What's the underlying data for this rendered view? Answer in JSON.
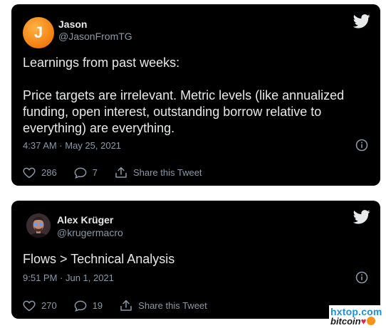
{
  "tweets": [
    {
      "avatar_letter": "J",
      "name": "Jason",
      "handle": "@JasonFromTG",
      "text_lines": [
        "Learnings from past weeks:",
        "",
        "Price targets are irrelevant.  Metric levels (like annualized",
        "funding, open interest, outstanding borrow relative to",
        "everything) are everything."
      ],
      "timestamp": "4:37 AM · May 25, 2021",
      "likes": "286",
      "replies": "7",
      "share_label": "Share this Tweet"
    },
    {
      "name": "Alex Krüger",
      "handle": "@krugermacro",
      "text_lines": [
        "Flows > Technical Analysis"
      ],
      "timestamp": "9:51 PM · Jun 1, 2021",
      "likes": "270",
      "replies": "19",
      "share_label": "Share this Tweet"
    }
  ],
  "watermark": {
    "site": "hxtop.com",
    "brand": "bitcoin"
  },
  "colors": {
    "card_background": "#000000",
    "text_primary": "#e7e9ea",
    "text_secondary": "#8b98a5",
    "twitter_bird": "#e7e9ea",
    "avatar_orange": "#f27d0c"
  },
  "icons": [
    "twitter-bird-icon",
    "info-icon",
    "heart-icon",
    "reply-icon",
    "share-icon"
  ]
}
